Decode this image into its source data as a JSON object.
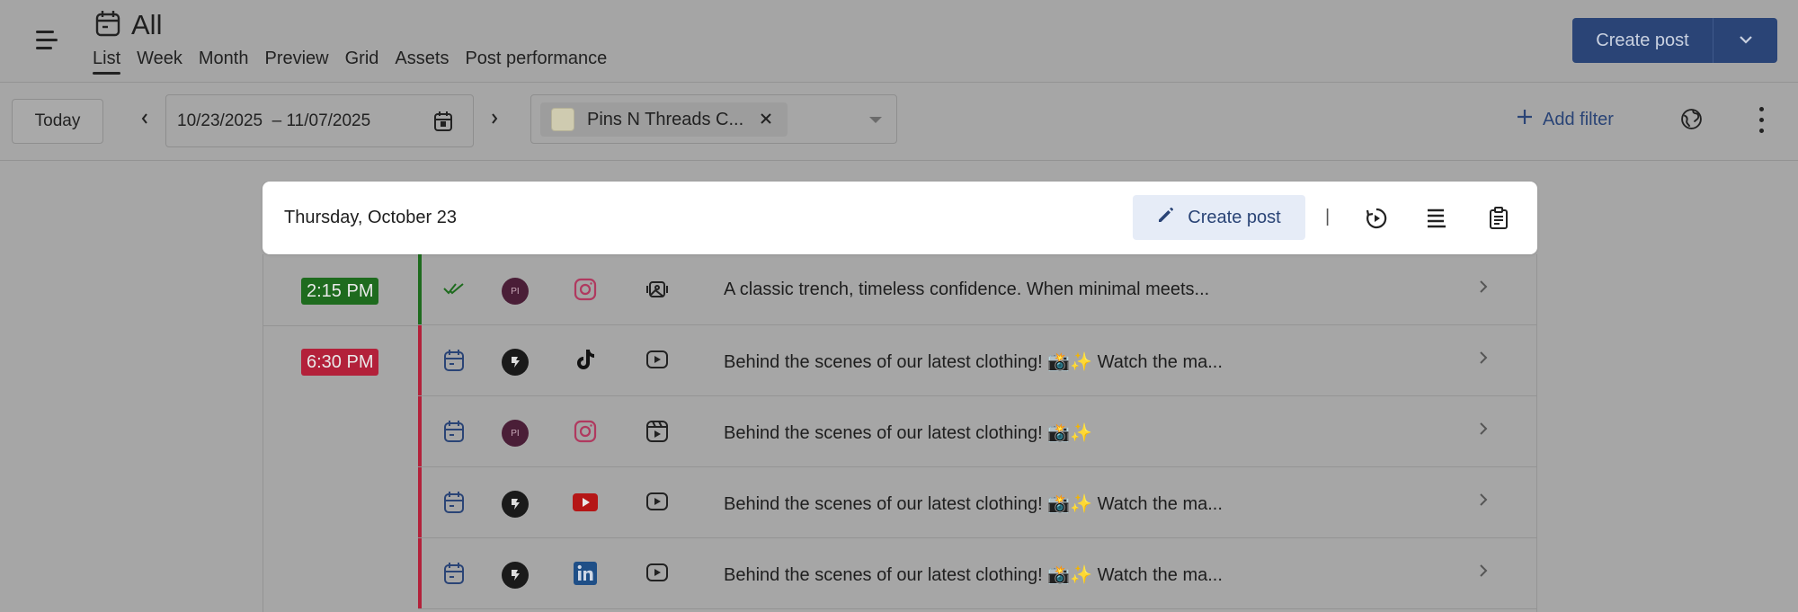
{
  "header": {
    "title": "All",
    "tabs": [
      {
        "label": "List",
        "active": true
      },
      {
        "label": "Week"
      },
      {
        "label": "Month"
      },
      {
        "label": "Preview"
      },
      {
        "label": "Grid"
      },
      {
        "label": "Assets"
      },
      {
        "label": "Post performance"
      }
    ],
    "create_post_label": "Create post"
  },
  "toolbar": {
    "today_label": "Today",
    "date_range": "10/23/2025  – 11/07/2025",
    "account_chip": "Pins N Threads C...",
    "add_filter_label": "Add filter"
  },
  "day": {
    "weekday": "Thursday",
    "date": ", October 23",
    "create_post_label": "Create post",
    "separator": "|"
  },
  "time_slots": [
    {
      "time": "2:15 PM",
      "color": "#1e6b1e"
    },
    {
      "time": "6:30 PM",
      "color": "#b3213a"
    }
  ],
  "posts": [
    {
      "status_icon": "double-check-icon",
      "avatar": "pi",
      "avatar_text": "PI",
      "network": "instagram-icon",
      "type": "gallery-icon",
      "caption": "A classic trench, timeless confidence. When minimal meets...",
      "bar_color": "#1e6b1e"
    },
    {
      "status_icon": "calendar-icon",
      "avatar": "dark",
      "avatar_text": "",
      "network": "tiktok-icon",
      "type": "video-icon",
      "caption": "Behind the scenes of our latest clothing! 📸✨ Watch the ma...",
      "bar_color": "#b3213a"
    },
    {
      "status_icon": "calendar-icon",
      "avatar": "pi",
      "avatar_text": "PI",
      "network": "instagram-icon",
      "type": "reel-icon",
      "caption": "Behind the scenes of our latest clothing! 📸✨",
      "bar_color": "#b3213a"
    },
    {
      "status_icon": "calendar-icon",
      "avatar": "dark",
      "avatar_text": "",
      "network": "youtube-icon",
      "type": "video-icon",
      "caption": "Behind the scenes of our latest clothing! 📸✨ Watch the ma...",
      "bar_color": "#b3213a"
    },
    {
      "status_icon": "calendar-icon",
      "avatar": "dark",
      "avatar_text": "",
      "network": "linkedin-icon",
      "type": "video-icon",
      "caption": "Behind the scenes of our latest clothing! 📸✨ Watch the ma...",
      "bar_color": "#b3213a"
    }
  ],
  "colors": {
    "primary": "#2a4476",
    "published": "#1e6b1e",
    "scheduled": "#b3213a",
    "instagram": "#b0395f",
    "youtube": "#b51616",
    "linkedin": "#1f4f87"
  }
}
